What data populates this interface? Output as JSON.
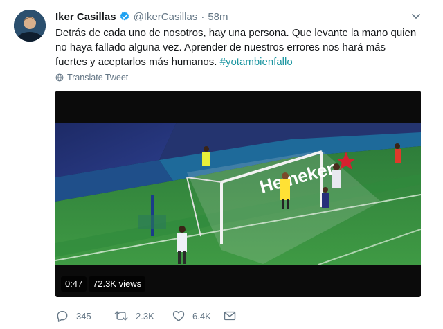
{
  "tweet": {
    "author_name": "Iker Casillas",
    "handle": "@IkerCasillas",
    "separator": "·",
    "time": "58m",
    "text_main": "Detrás de cada uno de nosotros, hay una persona. Que levante la mano quien no haya fallado alguna vez. Aprender de nuestros errores nos hará más fuertes y aceptarlos más humanos.",
    "hashtag": "#yotambienfallo",
    "translate_label": "Translate Tweet"
  },
  "video": {
    "duration": "0:47",
    "views": "72.3K views",
    "ad_board_text": "Heineken"
  },
  "actions": {
    "replies": "345",
    "retweets": "2.3K",
    "likes": "6.4K"
  },
  "colors": {
    "hashtag": "#1b95a0",
    "muted": "#657786",
    "verified": "#1da1f2"
  },
  "icons": [
    "verified-icon",
    "chevron-down-icon",
    "globe-icon",
    "reply-icon",
    "retweet-icon",
    "like-icon",
    "dm-icon"
  ]
}
